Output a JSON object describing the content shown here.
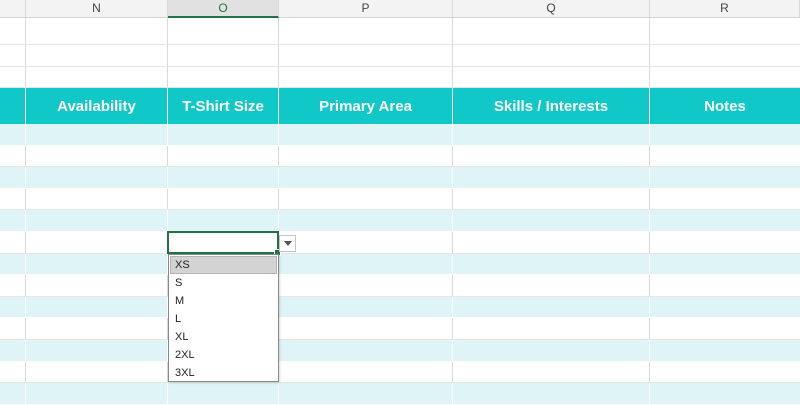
{
  "columns": [
    "N",
    "O",
    "P",
    "Q",
    "R"
  ],
  "header_row": {
    "availability": "Availability",
    "tshirt_size": "T-Shirt Size",
    "primary_area": "Primary Area",
    "skills_interests": "Skills / Interests",
    "notes": "Notes"
  },
  "dropdown": {
    "options": [
      "XS",
      "S",
      "M",
      "L",
      "XL",
      "2XL",
      "3XL"
    ],
    "highlighted": "XS"
  },
  "colors": {
    "header_fill": "#10c8c8",
    "band_fill": "#dff4f6",
    "selection_accent": "#217346"
  }
}
